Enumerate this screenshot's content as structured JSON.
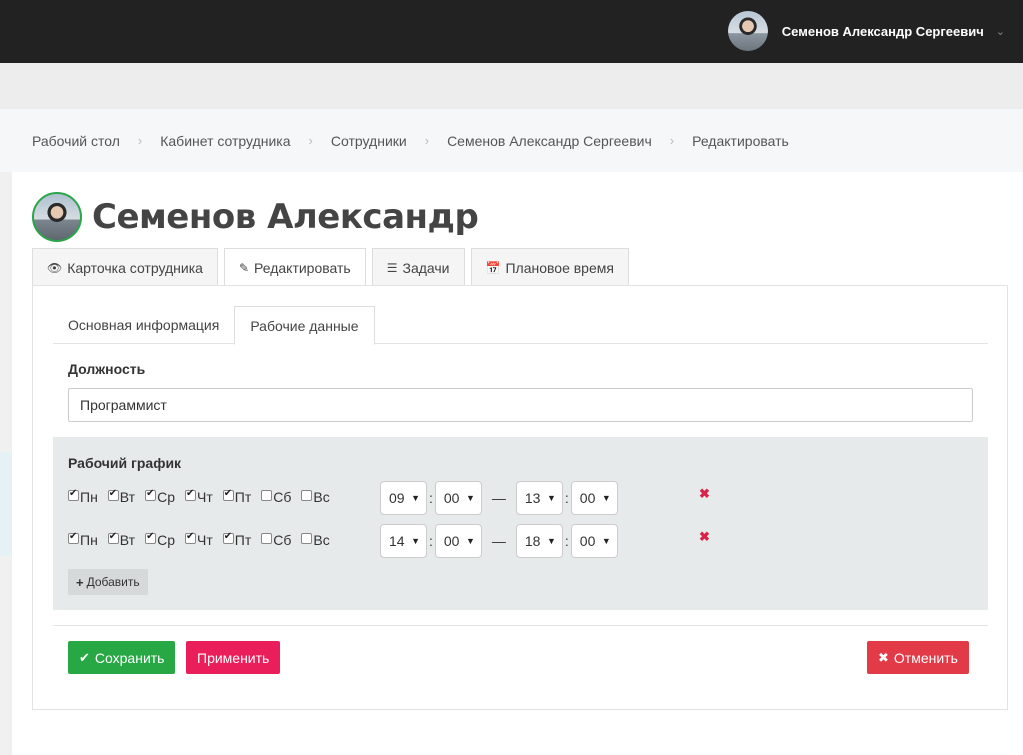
{
  "user": {
    "name": "Семенов Александр Сергеевич",
    "chevron": "chevron-down-icon"
  },
  "breadcrumb": [
    "Рабочий стол",
    "Кабинет сотрудника",
    "Сотрудники",
    "Семенов Александр Сергеевич",
    "Редактировать"
  ],
  "profile": {
    "name": "Семенов Александр"
  },
  "tabs": [
    {
      "label": "Карточка сотрудника",
      "icon": "eye-icon"
    },
    {
      "label": "Редактировать",
      "icon": "edit-icon"
    },
    {
      "label": "Задачи",
      "icon": "tasks-icon"
    },
    {
      "label": "Плановое время",
      "icon": "calendar-plus-icon"
    }
  ],
  "inner_tabs": [
    "Основная информация",
    "Рабочие данные"
  ],
  "position": {
    "label": "Должность",
    "value": "Программист"
  },
  "schedule": {
    "title": "Рабочий график",
    "days": [
      "Пн",
      "Вт",
      "Ср",
      "Чт",
      "Пт",
      "Сб",
      "Вс"
    ],
    "rows": [
      {
        "checked": [
          true,
          true,
          true,
          true,
          true,
          false,
          false
        ],
        "start_h": "09",
        "start_m": "00",
        "end_h": "13",
        "end_m": "00"
      },
      {
        "checked": [
          true,
          true,
          true,
          true,
          true,
          false,
          false
        ],
        "start_h": "14",
        "start_m": "00",
        "end_h": "18",
        "end_m": "00"
      }
    ],
    "add_label": "Добавить"
  },
  "actions": {
    "save": "Сохранить",
    "apply": "Применить",
    "cancel": "Отменить"
  },
  "colors": {
    "save": "#28a745",
    "apply": "#e91e5a",
    "cancel": "#e33a47",
    "remove": "#d9234a"
  }
}
